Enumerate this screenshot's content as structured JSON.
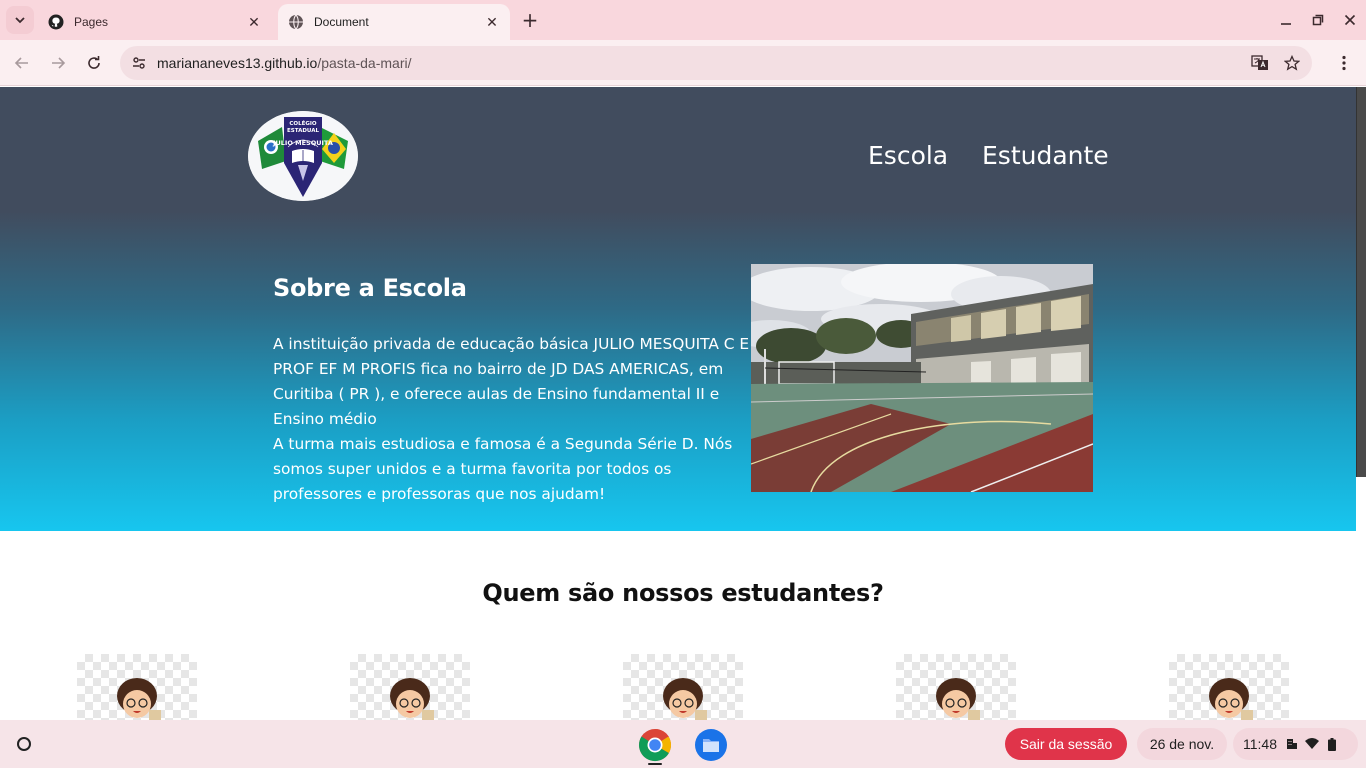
{
  "browser": {
    "tabs": [
      {
        "label": "Pages",
        "icon": "github-icon"
      },
      {
        "label": "Document",
        "icon": "globe-icon",
        "active": true
      }
    ],
    "url_host": "mariananeves13.github.io",
    "url_path": "/pasta-da-mari/"
  },
  "page": {
    "nav": [
      "Escola",
      "Estudante"
    ],
    "about_title": "Sobre a Escola",
    "about_text_1": "A instituição privada de educação básica JULIO MESQUITA C E PROF EF M PROFIS fica no bairro de JD DAS AMERICAS, em Curitiba ( PR ), e oferece aulas de Ensino fundamental II e Ensino médio",
    "about_text_2": "A turma mais estudiosa e famosa é a Segunda Série D. Nós somos super unidos e a turma favorita por todos os professores e professoras que nos ajudam!",
    "logo_text": [
      "COLÉGIO",
      "ESTADUAL",
      "JULIO MESQUITA"
    ],
    "students_title": "Quem são nossos estudantes?",
    "student_count": 5,
    "colors": {
      "hero_top": "#414c5e",
      "hero_bottom": "#17c6ef"
    }
  },
  "shelf": {
    "signout_label": "Sair da sessão",
    "date": "26 de nov.",
    "time": "11:48",
    "apps": [
      "chrome-icon",
      "files-icon"
    ]
  }
}
